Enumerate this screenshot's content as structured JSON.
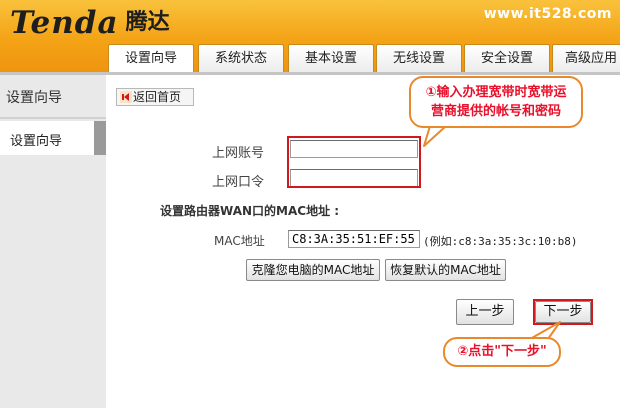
{
  "header": {
    "logo_text": "Tenda",
    "logo_text_cn": "腾达",
    "site_url": "www.it528.com"
  },
  "tabs": [
    {
      "label": "设置向导",
      "active": true
    },
    {
      "label": "系统状态",
      "active": false
    },
    {
      "label": "基本设置",
      "active": false
    },
    {
      "label": "无线设置",
      "active": false
    },
    {
      "label": "安全设置",
      "active": false
    },
    {
      "label": "高级应用",
      "active": false
    }
  ],
  "sidebar": {
    "title": "设置向导",
    "items": [
      {
        "label": "设置向导"
      }
    ]
  },
  "main": {
    "back_label": "返回首页",
    "account_label": "上网账号",
    "account_value": "",
    "password_label": "上网口令",
    "password_value": "",
    "mac_section_title": "设置路由器WAN口的MAC地址 :",
    "mac_label": "MAC地址",
    "mac_value": "C8:3A:35:51:EF:55",
    "mac_example": "(例如:c8:3a:35:3c:10:b8)",
    "clone_mac_button": "克隆您电脑的MAC地址",
    "restore_mac_button": "恢复默认的MAC地址",
    "prev_button": "上一步",
    "next_button": "下一步"
  },
  "annotations": {
    "callout_1_line1": "①输入办理宽带时宽带运",
    "callout_1_line2": "营商提供的帐号和密码",
    "callout_2": "②点击\"下一步\""
  },
  "colors": {
    "header_orange": "#f4a316",
    "highlight_red": "#d0191f",
    "callout_border": "#e9892b",
    "callout_text": "#e8102a"
  }
}
